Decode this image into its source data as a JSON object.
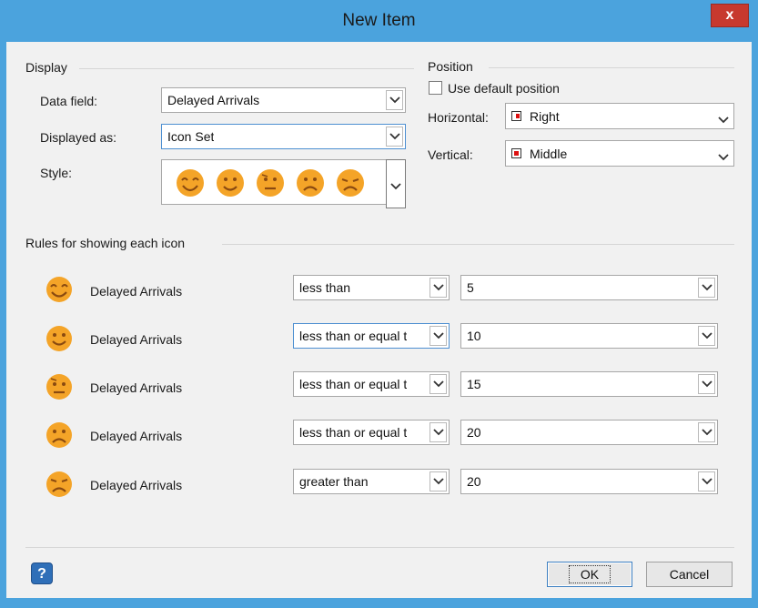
{
  "window": {
    "title": "New Item",
    "close_label": "x"
  },
  "display": {
    "section": "Display",
    "data_field_label": "Data field:",
    "data_field_value": "Delayed Arrivals",
    "displayed_as_label": "Displayed as:",
    "displayed_as_value": "Icon Set",
    "style_label": "Style:"
  },
  "position": {
    "section": "Position",
    "use_default_label": "Use default position",
    "use_default_checked": false,
    "horizontal_label": "Horizontal:",
    "horizontal_value": "Right",
    "vertical_label": "Vertical:",
    "vertical_value": "Middle"
  },
  "rules": {
    "section": "Rules for showing each icon",
    "items": [
      {
        "icon": "laughing-face-icon",
        "field": "Delayed Arrivals",
        "operator": "less than",
        "value": "5"
      },
      {
        "icon": "smiling-face-icon",
        "field": "Delayed Arrivals",
        "operator": "less than or equal t",
        "value": "10"
      },
      {
        "icon": "worried-face-icon",
        "field": "Delayed Arrivals",
        "operator": "less than or equal t",
        "value": "15"
      },
      {
        "icon": "frowning-face-icon",
        "field": "Delayed Arrivals",
        "operator": "less than or equal t",
        "value": "20"
      },
      {
        "icon": "crying-face-icon",
        "field": "Delayed Arrivals",
        "operator": "greater than",
        "value": "20"
      }
    ]
  },
  "buttons": {
    "ok": "OK",
    "cancel": "Cancel",
    "help": "?"
  },
  "colors": {
    "titlebar": "#4ba3dd",
    "close": "#c7392e",
    "face": "#f4a428",
    "face_dark": "#b3671b",
    "client": "#f1f1f1"
  }
}
